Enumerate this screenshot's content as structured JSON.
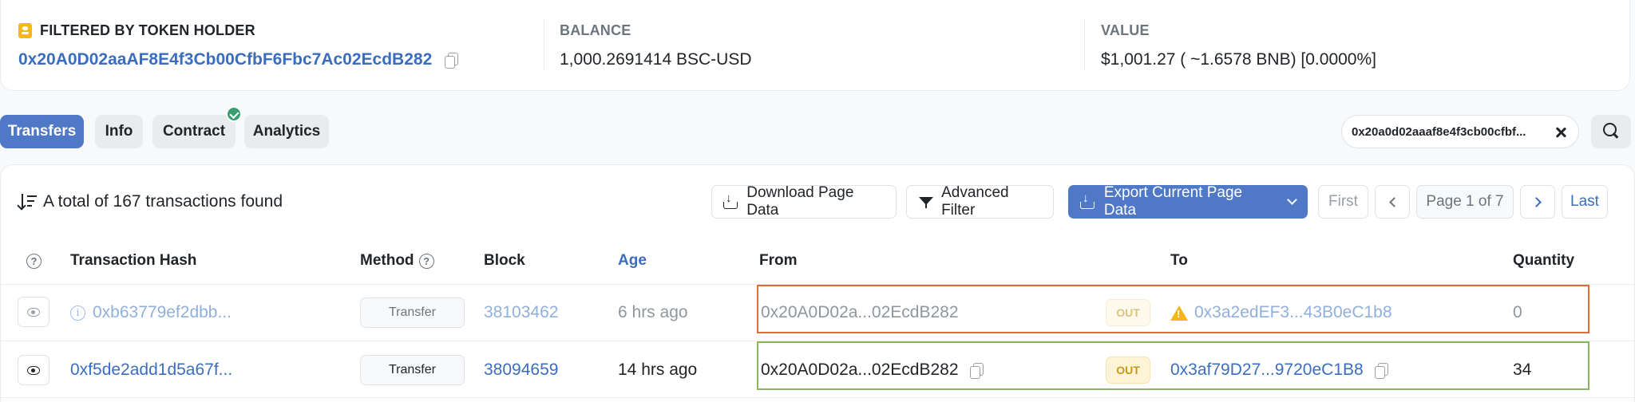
{
  "summary": {
    "holder": {
      "label": "FILTERED BY TOKEN HOLDER",
      "address": "0x20A0D02aaAF8E4f3Cb00CfbF6Fbc7Ac02EcdB282"
    },
    "balance": {
      "label": "BALANCE",
      "value": "1,000.2691414 BSC-USD"
    },
    "value": {
      "label": "VALUE",
      "value": "$1,001.27 ( ~1.6578 BNB) [0.0000%]"
    }
  },
  "tabs": [
    {
      "label": "Transfers",
      "active": true
    },
    {
      "label": "Info",
      "active": false
    },
    {
      "label": "Contract",
      "active": false,
      "verified": true
    },
    {
      "label": "Analytics",
      "active": false
    }
  ],
  "filter_chip": {
    "text": "0x20a0d02aaaf8e4f3cb00cfbf..."
  },
  "toolbar": {
    "total_text": "A total of 167 transactions found",
    "download_label": "Download Page Data",
    "advanced_filter_label": "Advanced Filter",
    "export_label": "Export Current Page Data"
  },
  "pagination": {
    "first": "First",
    "info": "Page 1 of 7",
    "last": "Last"
  },
  "table": {
    "headers": {
      "transaction_hash": "Transaction Hash",
      "method": "Method",
      "block": "Block",
      "age": "Age",
      "from": "From",
      "to": "To",
      "quantity": "Quantity"
    },
    "rows": [
      {
        "hash": "0xb63779ef2dbb...",
        "method": "Transfer",
        "block": "38103462",
        "age": "6 hrs ago",
        "from": "0x20A0D02a...02EcdB282",
        "direction": "OUT",
        "to": "0x3a2edEF3...43B0eC1b8",
        "quantity": "0",
        "muted": true,
        "to_warning": true
      },
      {
        "hash": "0xf5de2add1d5a67f...",
        "method": "Transfer",
        "block": "38094659",
        "age": "14 hrs ago",
        "from": "0x20A0D02a...02EcdB282",
        "direction": "OUT",
        "to": "0x3af79D27...9720eC1B8",
        "quantity": "34",
        "muted": false,
        "to_warning": false
      }
    ]
  },
  "colors": {
    "accent": "#4f79c6",
    "link": "#3b6dbf",
    "highlight_red": "#e06a3c",
    "highlight_green": "#8bb45c",
    "out_badge": "#c89a12"
  }
}
